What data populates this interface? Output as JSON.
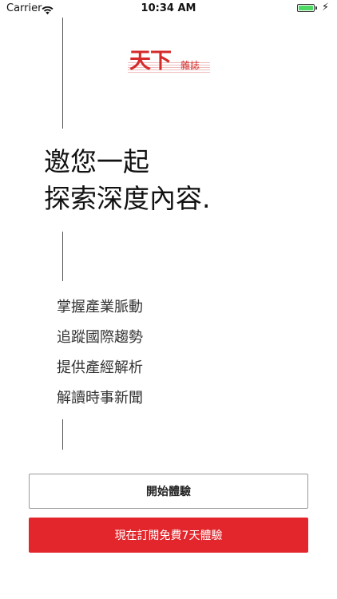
{
  "status_bar": {
    "carrier": "Carrier",
    "time": "10:34 AM",
    "battery_level": 1.0,
    "battery_color": "#4cd964",
    "wifi_icon": "wifi-icon",
    "charging_icon": "bolt-icon"
  },
  "logo": {
    "main": "天下",
    "sub": "雜誌",
    "color": "#d52b2b"
  },
  "headline": {
    "line1": "邀您一起",
    "line2": "探索深度內容."
  },
  "features": [
    "掌握產業脈動",
    "追蹤國際趨勢",
    "提供產經解析",
    "解讀時事新聞"
  ],
  "buttons": {
    "start_label": "開始體驗",
    "subscribe_label": "現在訂閱免費7天體驗",
    "subscribe_color": "#e3262c"
  }
}
